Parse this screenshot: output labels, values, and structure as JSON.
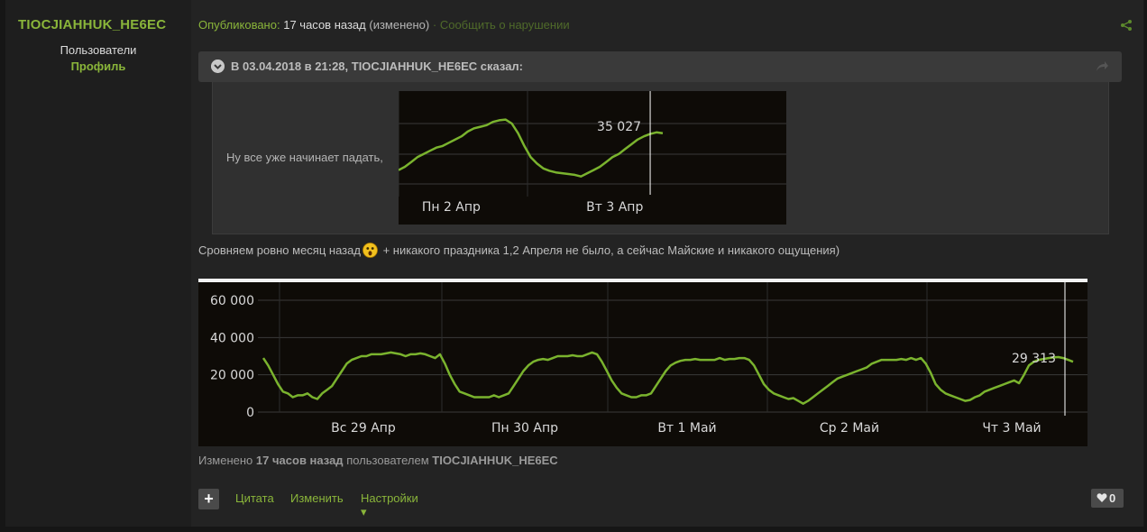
{
  "author": {
    "name": "TIOCJIAHHUK_HE6EC",
    "group": "Пользователи",
    "profile_link": "Профиль"
  },
  "meta": {
    "published_label": "Опубликовано:",
    "published_time": "17 часов назад",
    "edited_flag": "(изменено)",
    "separator": "·",
    "report_link": "Сообщить о нарушении"
  },
  "quote": {
    "header": "В 03.04.2018 в 21:28, TIOCJIAHHUK_HE6EC сказал:",
    "text": "Ну все уже начинает падать,"
  },
  "body": {
    "text_before": "Сровняем ровно месяц назад",
    "text_after": " + никакого праздника 1,2 Апреля не было, а сейчас Майские и никакого ощущения)"
  },
  "edited_note": {
    "prefix": "Изменено",
    "time": "17 часов назад",
    "middle": "пользователем",
    "user": "TIOCJIAHHUK_HE6EC"
  },
  "actions": {
    "plus_label": "+",
    "quote_label": "Цитата",
    "edit_label": "Изменить",
    "settings_label": "Настройки ▾",
    "like_count": "0"
  },
  "icons": {
    "share": "share-icon",
    "quote_toggle": "chevron-down-icon",
    "quote_jump": "arrow-jump-icon",
    "emoji": "surprised-emoji-icon",
    "like": "heart-icon"
  },
  "colors": {
    "accent": "#8ab53a",
    "line": "#7ab32e",
    "chart_bg": "#0e0b07",
    "grid": "#3a3a3a"
  },
  "chart_data": [
    {
      "type": "line",
      "title": "",
      "xlabel": "",
      "ylabel": "",
      "ylim": [
        0,
        60000
      ],
      "x_ticks": [
        "Пн 2 Апр",
        "Вт 3 Апр"
      ],
      "cursor_label": "35 027",
      "x": [
        0,
        1,
        2,
        3,
        4,
        5,
        6,
        7,
        8,
        9,
        10,
        11,
        12,
        13,
        14,
        15,
        16,
        17,
        18,
        19,
        20,
        21,
        22,
        23,
        24,
        25,
        26,
        27,
        28,
        29,
        30,
        31,
        32,
        33,
        34,
        35,
        36,
        37,
        38,
        39,
        40,
        41,
        42
      ],
      "values": [
        7000,
        9000,
        12000,
        15000,
        17000,
        19000,
        21000,
        22000,
        24000,
        26000,
        28000,
        31000,
        33000,
        34000,
        35000,
        37000,
        38000,
        38500,
        36000,
        30000,
        22000,
        15000,
        11000,
        8000,
        6500,
        5500,
        5000,
        4500,
        4000,
        3000,
        5000,
        7000,
        9000,
        12000,
        15000,
        17000,
        20000,
        23000,
        26000,
        28000,
        29500,
        30500,
        30000
      ],
      "x_tick_positions": [
        5.5,
        31.5
      ],
      "cursor_index": 40
    },
    {
      "type": "line",
      "title": "",
      "xlabel": "",
      "ylabel": "",
      "ylim": [
        0,
        60000
      ],
      "y_ticks": [
        "0",
        "20 000",
        "40 000",
        "60 000"
      ],
      "y_tick_values": [
        0,
        20000,
        40000,
        60000
      ],
      "x_ticks": [
        "Вс 29 Апр",
        "Пн 30 Апр",
        "Вт 1 Май",
        "Ср 2 Май",
        "Чт 3 Май"
      ],
      "cursor_label": "29 313",
      "values": [
        29000,
        25000,
        20000,
        15000,
        11000,
        10000,
        8000,
        9000,
        9000,
        10000,
        8000,
        7000,
        10000,
        12000,
        14000,
        18000,
        22000,
        26000,
        28000,
        29000,
        30000,
        30000,
        31000,
        31000,
        31000,
        31500,
        32000,
        31500,
        31000,
        30000,
        31000,
        31000,
        31500,
        31000,
        30000,
        29000,
        31000,
        26000,
        20000,
        15000,
        11000,
        10000,
        9000,
        8000,
        8000,
        8000,
        8000,
        9000,
        8000,
        9000,
        10000,
        14000,
        18000,
        22000,
        25000,
        27000,
        28000,
        28500,
        28000,
        29000,
        30000,
        30000,
        30000,
        30500,
        30000,
        30000,
        31000,
        32000,
        31000,
        27000,
        22000,
        17000,
        13000,
        10000,
        9000,
        8000,
        8000,
        9000,
        9000,
        10000,
        14000,
        18000,
        22000,
        25000,
        26500,
        27500,
        28000,
        28000,
        28500,
        28000,
        28000,
        28000,
        28000,
        29000,
        28000,
        28500,
        28500,
        29000,
        29000,
        28000,
        25000,
        20000,
        15000,
        12000,
        10000,
        9000,
        8000,
        7000,
        7500,
        6000,
        4500,
        6000,
        8000,
        10000,
        12000,
        14000,
        16000,
        18000,
        19000,
        20000,
        21000,
        22000,
        23000,
        24000,
        26000,
        27000,
        28000,
        28000,
        28000,
        28000,
        28500,
        28000,
        29000,
        28000,
        29000,
        26000,
        21000,
        15000,
        12000,
        10000,
        9000,
        8000,
        7000,
        6000,
        6500,
        8000,
        9000,
        11000,
        12000,
        13000,
        14000,
        15000,
        16000,
        17000,
        15500,
        20000,
        25000,
        27000,
        28000,
        28500,
        29000,
        29313,
        29500,
        29000,
        28000,
        27000
      ]
    }
  ]
}
